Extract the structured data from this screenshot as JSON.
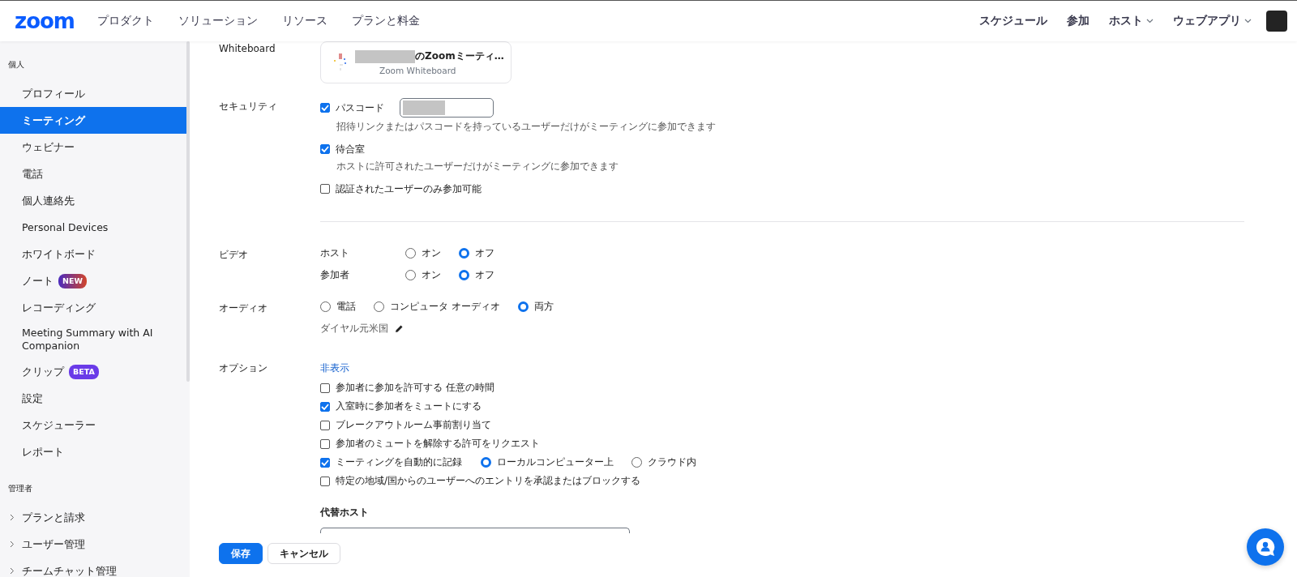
{
  "header": {
    "logo": "zoom",
    "nav": [
      "プロダクト",
      "ソリューション",
      "リソース",
      "プランと料金"
    ],
    "right": [
      {
        "label": "スケジュール",
        "dropdown": false
      },
      {
        "label": "参加",
        "dropdown": false
      },
      {
        "label": "ホスト",
        "dropdown": true
      },
      {
        "label": "ウェブアプリ",
        "dropdown": true
      }
    ]
  },
  "sidebar": {
    "sections": [
      {
        "title": "個人",
        "items": [
          {
            "label": "プロフィール",
            "selected": false
          },
          {
            "label": "ミーティング",
            "selected": true
          },
          {
            "label": "ウェビナー",
            "selected": false
          },
          {
            "label": "電話",
            "selected": false
          },
          {
            "label": "個人連絡先",
            "selected": false
          },
          {
            "label": "Personal Devices",
            "selected": false
          },
          {
            "label": "ホワイトボード",
            "selected": false
          },
          {
            "label": "ノート",
            "selected": false,
            "badge": {
              "text": "NEW",
              "kind": "new"
            }
          },
          {
            "label": "レコーディング",
            "selected": false
          },
          {
            "label": "Meeting Summary with AI Companion",
            "selected": false
          },
          {
            "label": "クリップ",
            "selected": false,
            "badge": {
              "text": "BETA",
              "kind": "beta"
            }
          },
          {
            "label": "設定",
            "selected": false
          },
          {
            "label": "スケジューラー",
            "selected": false
          },
          {
            "label": "レポート",
            "selected": false
          }
        ]
      },
      {
        "title": "管理者",
        "items": [
          {
            "label": "プランと請求",
            "selected": false,
            "expanded": false
          },
          {
            "label": "ユーザー管理",
            "selected": false,
            "expanded": false
          },
          {
            "label": "チームチャット管理",
            "selected": false,
            "expanded": false
          }
        ]
      }
    ]
  },
  "whiteboard": {
    "label": "Whiteboard",
    "title": "のZoomミーティ…",
    "subtitle": "Zoom Whiteboard"
  },
  "security": {
    "label": "セキュリティ",
    "options": [
      {
        "label": "パスコード",
        "checked": true,
        "field": true,
        "note": "招待リンクまたはパスコードを持っているユーザーだけがミーティングに参加できます"
      },
      {
        "label": "待合室",
        "checked": true,
        "note": "ホストに許可されたユーザーだけがミーティングに参加できます"
      },
      {
        "label": "認証されたユーザーのみ参加可能",
        "checked": false
      }
    ]
  },
  "video": {
    "label": "ビデオ",
    "rows": [
      {
        "label": "ホスト",
        "options": [
          {
            "label": "オン",
            "selected": false
          },
          {
            "label": "オフ",
            "selected": true
          }
        ]
      },
      {
        "label": "参加者",
        "options": [
          {
            "label": "オン",
            "selected": false
          },
          {
            "label": "オフ",
            "selected": true
          }
        ]
      }
    ]
  },
  "audio": {
    "label": "オーディオ",
    "options": [
      {
        "label": "電話",
        "selected": false
      },
      {
        "label": "コンピュータ オーディオ",
        "selected": false
      },
      {
        "label": "両方",
        "selected": true
      }
    ],
    "dial": "ダイヤル元米国"
  },
  "options": {
    "label": "オプション",
    "toggle": "非表示",
    "items": [
      {
        "label": "参加者に参加を許可する 任意の時間",
        "checked": false
      },
      {
        "label": "入室時に参加者をミュートにする",
        "checked": true
      },
      {
        "label": "ブレークアウトルーム事前割り当て",
        "checked": false
      },
      {
        "label": "参加者のミュートを解除する許可をリクエスト",
        "checked": false
      },
      {
        "label": "ミーティングを自動的に記録",
        "checked": true,
        "choices": [
          {
            "label": "ローカルコンピューター上",
            "selected": true
          },
          {
            "label": "クラウド内",
            "selected": false
          }
        ]
      },
      {
        "label": "特定の地域/国からのユーザーへのエントリを承認またはブロックする",
        "checked": false
      }
    ],
    "alt_host_label": "代替ホスト"
  },
  "buttons": [
    {
      "label": "保存",
      "kind": "primary"
    },
    {
      "label": "キャンセル",
      "kind": "secondary"
    }
  ]
}
